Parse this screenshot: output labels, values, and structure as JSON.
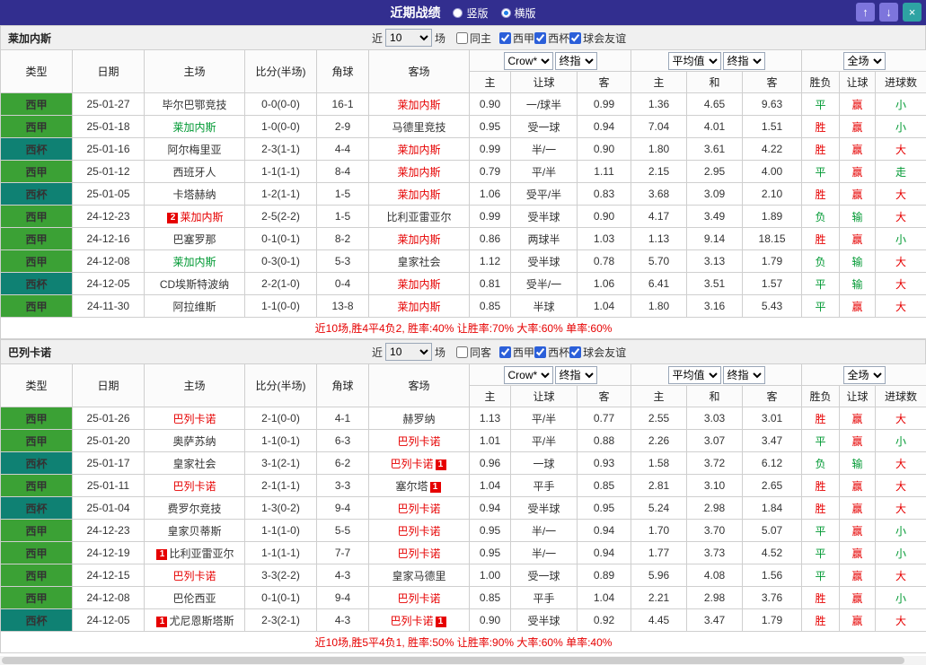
{
  "palette": {
    "red": "#e60000",
    "green": "#009933",
    "black": "#333333"
  },
  "league_colors": {
    "西甲": "#3ba135",
    "西杯": "#0f8173"
  },
  "titlebar": {
    "title": "近期战绩",
    "modes": [
      {
        "label": "竖版",
        "selected": false
      },
      {
        "label": "横版",
        "selected": true
      }
    ],
    "up_icon": "↑",
    "down_icon": "↓",
    "close_icon": "×"
  },
  "filters": {
    "near_label": "近",
    "count": "10",
    "games_label": "场",
    "league_labels": [
      "西甲",
      "西杯",
      "球会友谊"
    ],
    "leagues_checked": [
      true,
      true,
      true
    ]
  },
  "dropdowns": {
    "bookmaker": "Crow*",
    "final_label": "终指",
    "average_label": "平均值",
    "fulltime_label": "全场"
  },
  "headers": {
    "type": "类型",
    "date": "日期",
    "home": "主场",
    "score": "比分(半场)",
    "corner": "角球",
    "away": "客场",
    "asian": [
      "主",
      "让球",
      "客"
    ],
    "euro": [
      "主",
      "和",
      "客"
    ],
    "result": [
      "胜负",
      "让球",
      "进球数"
    ]
  },
  "sections": [
    {
      "team": "莱加内斯",
      "same_label": "同主",
      "same_checked": false,
      "footer": "近10场,胜4平4负2, 胜率:40% 让胜率:70% 大率:60% 单率:60%",
      "rows": [
        {
          "league": "西甲",
          "date": "25-01-27",
          "home": {
            "name": "毕尔巴鄂竞技",
            "color": "black"
          },
          "score": "0-0(0-0)",
          "corner": "16-1",
          "away": {
            "name": "莱加内斯",
            "color": "red"
          },
          "asian": [
            "0.90",
            "一/球半",
            "0.99"
          ],
          "euro": [
            "1.36",
            "4.65",
            "9.63"
          ],
          "results": [
            {
              "t": "平",
              "c": "green"
            },
            {
              "t": "赢",
              "c": "red"
            },
            {
              "t": "小",
              "c": "green"
            }
          ]
        },
        {
          "league": "西甲",
          "date": "25-01-18",
          "home": {
            "name": "莱加内斯",
            "color": "green"
          },
          "score": "1-0(0-0)",
          "corner": "2-9",
          "away": {
            "name": "马德里竞技",
            "color": "black"
          },
          "asian": [
            "0.95",
            "受一球",
            "0.94"
          ],
          "euro": [
            "7.04",
            "4.01",
            "1.51"
          ],
          "results": [
            {
              "t": "胜",
              "c": "red"
            },
            {
              "t": "赢",
              "c": "red"
            },
            {
              "t": "小",
              "c": "green"
            }
          ]
        },
        {
          "league": "西杯",
          "date": "25-01-16",
          "home": {
            "name": "阿尔梅里亚",
            "color": "black"
          },
          "score": "2-3(1-1)",
          "corner": "4-4",
          "away": {
            "name": "莱加内斯",
            "color": "red"
          },
          "asian": [
            "0.99",
            "半/一",
            "0.90"
          ],
          "euro": [
            "1.80",
            "3.61",
            "4.22"
          ],
          "results": [
            {
              "t": "胜",
              "c": "red"
            },
            {
              "t": "赢",
              "c": "red"
            },
            {
              "t": "大",
              "c": "red"
            }
          ]
        },
        {
          "league": "西甲",
          "date": "25-01-12",
          "home": {
            "name": "西班牙人",
            "color": "black"
          },
          "score": "1-1(1-1)",
          "corner": "8-4",
          "away": {
            "name": "莱加内斯",
            "color": "red"
          },
          "asian": [
            "0.79",
            "平/半",
            "1.11"
          ],
          "euro": [
            "2.15",
            "2.95",
            "4.00"
          ],
          "results": [
            {
              "t": "平",
              "c": "green"
            },
            {
              "t": "赢",
              "c": "red"
            },
            {
              "t": "走",
              "c": "green"
            }
          ]
        },
        {
          "league": "西杯",
          "date": "25-01-05",
          "home": {
            "name": "卡塔赫纳",
            "color": "black"
          },
          "score": "1-2(1-1)",
          "corner": "1-5",
          "away": {
            "name": "莱加内斯",
            "color": "red"
          },
          "asian": [
            "1.06",
            "受平/半",
            "0.83"
          ],
          "euro": [
            "3.68",
            "3.09",
            "2.10"
          ],
          "results": [
            {
              "t": "胜",
              "c": "red"
            },
            {
              "t": "赢",
              "c": "red"
            },
            {
              "t": "大",
              "c": "red"
            }
          ]
        },
        {
          "league": "西甲",
          "date": "24-12-23",
          "home": {
            "name": "莱加内斯",
            "color": "red",
            "badge": "2",
            "badge_side": "left"
          },
          "score": "2-5(2-2)",
          "corner": "1-5",
          "away": {
            "name": "比利亚雷亚尔",
            "color": "black"
          },
          "asian": [
            "0.99",
            "受半球",
            "0.90"
          ],
          "euro": [
            "4.17",
            "3.49",
            "1.89"
          ],
          "results": [
            {
              "t": "负",
              "c": "green"
            },
            {
              "t": "输",
              "c": "green"
            },
            {
              "t": "大",
              "c": "red"
            }
          ]
        },
        {
          "league": "西甲",
          "date": "24-12-16",
          "home": {
            "name": "巴塞罗那",
            "color": "black"
          },
          "score": "0-1(0-1)",
          "corner": "8-2",
          "away": {
            "name": "莱加内斯",
            "color": "red"
          },
          "asian": [
            "0.86",
            "两球半",
            "1.03"
          ],
          "euro": [
            "1.13",
            "9.14",
            "18.15"
          ],
          "results": [
            {
              "t": "胜",
              "c": "red"
            },
            {
              "t": "赢",
              "c": "red"
            },
            {
              "t": "小",
              "c": "green"
            }
          ]
        },
        {
          "league": "西甲",
          "date": "24-12-08",
          "home": {
            "name": "莱加内斯",
            "color": "green"
          },
          "score": "0-3(0-1)",
          "corner": "5-3",
          "away": {
            "name": "皇家社会",
            "color": "black"
          },
          "asian": [
            "1.12",
            "受半球",
            "0.78"
          ],
          "euro": [
            "5.70",
            "3.13",
            "1.79"
          ],
          "results": [
            {
              "t": "负",
              "c": "green"
            },
            {
              "t": "输",
              "c": "green"
            },
            {
              "t": "大",
              "c": "red"
            }
          ]
        },
        {
          "league": "西杯",
          "date": "24-12-05",
          "home": {
            "name": "CD埃斯特波纳",
            "color": "black"
          },
          "score": "2-2(1-0)",
          "corner": "0-4",
          "away": {
            "name": "莱加内斯",
            "color": "red"
          },
          "asian": [
            "0.81",
            "受半/一",
            "1.06"
          ],
          "euro": [
            "6.41",
            "3.51",
            "1.57"
          ],
          "results": [
            {
              "t": "平",
              "c": "green"
            },
            {
              "t": "输",
              "c": "green"
            },
            {
              "t": "大",
              "c": "red"
            }
          ]
        },
        {
          "league": "西甲",
          "date": "24-11-30",
          "home": {
            "name": "阿拉维斯",
            "color": "black"
          },
          "score": "1-1(0-0)",
          "corner": "13-8",
          "away": {
            "name": "莱加内斯",
            "color": "red"
          },
          "asian": [
            "0.85",
            "半球",
            "1.04"
          ],
          "euro": [
            "1.80",
            "3.16",
            "5.43"
          ],
          "results": [
            {
              "t": "平",
              "c": "green"
            },
            {
              "t": "赢",
              "c": "red"
            },
            {
              "t": "大",
              "c": "red"
            }
          ]
        }
      ]
    },
    {
      "team": "巴列卡诺",
      "same_label": "同客",
      "same_checked": false,
      "footer": "近10场,胜5平4负1, 胜率:50% 让胜率:90% 大率:60% 单率:40%",
      "rows": [
        {
          "league": "西甲",
          "date": "25-01-26",
          "home": {
            "name": "巴列卡诺",
            "color": "red"
          },
          "score": "2-1(0-0)",
          "corner": "4-1",
          "away": {
            "name": "赫罗纳",
            "color": "black"
          },
          "asian": [
            "1.13",
            "平/半",
            "0.77"
          ],
          "euro": [
            "2.55",
            "3.03",
            "3.01"
          ],
          "results": [
            {
              "t": "胜",
              "c": "red"
            },
            {
              "t": "赢",
              "c": "red"
            },
            {
              "t": "大",
              "c": "red"
            }
          ]
        },
        {
          "league": "西甲",
          "date": "25-01-20",
          "home": {
            "name": "奥萨苏纳",
            "color": "black"
          },
          "score": "1-1(0-1)",
          "corner": "6-3",
          "away": {
            "name": "巴列卡诺",
            "color": "red"
          },
          "asian": [
            "1.01",
            "平/半",
            "0.88"
          ],
          "euro": [
            "2.26",
            "3.07",
            "3.47"
          ],
          "results": [
            {
              "t": "平",
              "c": "green"
            },
            {
              "t": "赢",
              "c": "red"
            },
            {
              "t": "小",
              "c": "green"
            }
          ]
        },
        {
          "league": "西杯",
          "date": "25-01-17",
          "home": {
            "name": "皇家社会",
            "color": "black"
          },
          "score": "3-1(2-1)",
          "corner": "6-2",
          "away": {
            "name": "巴列卡诺",
            "color": "red",
            "badge": "1",
            "badge_side": "right"
          },
          "asian": [
            "0.96",
            "一球",
            "0.93"
          ],
          "euro": [
            "1.58",
            "3.72",
            "6.12"
          ],
          "results": [
            {
              "t": "负",
              "c": "green"
            },
            {
              "t": "输",
              "c": "green"
            },
            {
              "t": "大",
              "c": "red"
            }
          ]
        },
        {
          "league": "西甲",
          "date": "25-01-11",
          "home": {
            "name": "巴列卡诺",
            "color": "red"
          },
          "score": "2-1(1-1)",
          "corner": "3-3",
          "away": {
            "name": "塞尔塔",
            "color": "black",
            "badge": "1",
            "badge_side": "right"
          },
          "asian": [
            "1.04",
            "平手",
            "0.85"
          ],
          "euro": [
            "2.81",
            "3.10",
            "2.65"
          ],
          "results": [
            {
              "t": "胜",
              "c": "red"
            },
            {
              "t": "赢",
              "c": "red"
            },
            {
              "t": "大",
              "c": "red"
            }
          ]
        },
        {
          "league": "西杯",
          "date": "25-01-04",
          "home": {
            "name": "费罗尔竞技",
            "color": "black"
          },
          "score": "1-3(0-2)",
          "corner": "9-4",
          "away": {
            "name": "巴列卡诺",
            "color": "red"
          },
          "asian": [
            "0.94",
            "受半球",
            "0.95"
          ],
          "euro": [
            "5.24",
            "2.98",
            "1.84"
          ],
          "results": [
            {
              "t": "胜",
              "c": "red"
            },
            {
              "t": "赢",
              "c": "red"
            },
            {
              "t": "大",
              "c": "red"
            }
          ]
        },
        {
          "league": "西甲",
          "date": "24-12-23",
          "home": {
            "name": "皇家贝蒂斯",
            "color": "black"
          },
          "score": "1-1(1-0)",
          "corner": "5-5",
          "away": {
            "name": "巴列卡诺",
            "color": "red"
          },
          "asian": [
            "0.95",
            "半/一",
            "0.94"
          ],
          "euro": [
            "1.70",
            "3.70",
            "5.07"
          ],
          "results": [
            {
              "t": "平",
              "c": "green"
            },
            {
              "t": "赢",
              "c": "red"
            },
            {
              "t": "小",
              "c": "green"
            }
          ]
        },
        {
          "league": "西甲",
          "date": "24-12-19",
          "home": {
            "name": "比利亚雷亚尔",
            "color": "black",
            "badge": "1",
            "badge_side": "left"
          },
          "score": "1-1(1-1)",
          "corner": "7-7",
          "away": {
            "name": "巴列卡诺",
            "color": "red"
          },
          "asian": [
            "0.95",
            "半/一",
            "0.94"
          ],
          "euro": [
            "1.77",
            "3.73",
            "4.52"
          ],
          "results": [
            {
              "t": "平",
              "c": "green"
            },
            {
              "t": "赢",
              "c": "red"
            },
            {
              "t": "小",
              "c": "green"
            }
          ]
        },
        {
          "league": "西甲",
          "date": "24-12-15",
          "home": {
            "name": "巴列卡诺",
            "color": "red"
          },
          "score": "3-3(2-2)",
          "corner": "4-3",
          "away": {
            "name": "皇家马德里",
            "color": "black"
          },
          "asian": [
            "1.00",
            "受一球",
            "0.89"
          ],
          "euro": [
            "5.96",
            "4.08",
            "1.56"
          ],
          "results": [
            {
              "t": "平",
              "c": "green"
            },
            {
              "t": "赢",
              "c": "red"
            },
            {
              "t": "大",
              "c": "red"
            }
          ]
        },
        {
          "league": "西甲",
          "date": "24-12-08",
          "home": {
            "name": "巴伦西亚",
            "color": "black"
          },
          "score": "0-1(0-1)",
          "corner": "9-4",
          "away": {
            "name": "巴列卡诺",
            "color": "red"
          },
          "asian": [
            "0.85",
            "平手",
            "1.04"
          ],
          "euro": [
            "2.21",
            "2.98",
            "3.76"
          ],
          "results": [
            {
              "t": "胜",
              "c": "red"
            },
            {
              "t": "赢",
              "c": "red"
            },
            {
              "t": "小",
              "c": "green"
            }
          ]
        },
        {
          "league": "西杯",
          "date": "24-12-05",
          "home": {
            "name": "尤尼恩斯塔斯",
            "color": "black",
            "badge": "1",
            "badge_side": "left"
          },
          "score": "2-3(2-1)",
          "corner": "4-3",
          "away": {
            "name": "巴列卡诺",
            "color": "red",
            "badge": "1",
            "badge_side": "right"
          },
          "asian": [
            "0.90",
            "受半球",
            "0.92"
          ],
          "euro": [
            "4.45",
            "3.47",
            "1.79"
          ],
          "results": [
            {
              "t": "胜",
              "c": "red"
            },
            {
              "t": "赢",
              "c": "red"
            },
            {
              "t": "大",
              "c": "red"
            }
          ]
        }
      ]
    }
  ]
}
